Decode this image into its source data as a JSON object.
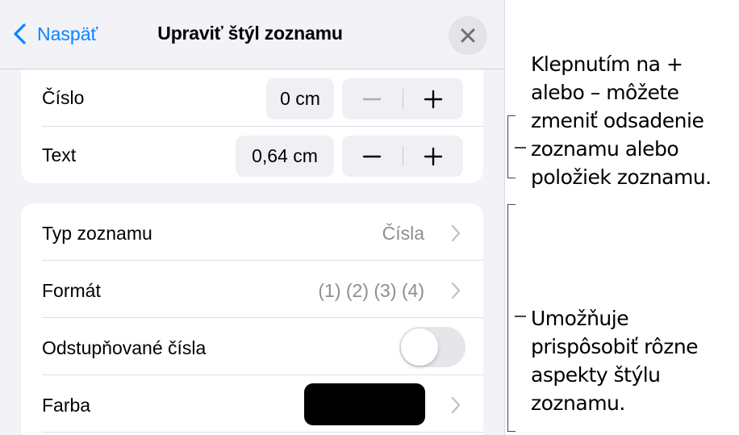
{
  "nav": {
    "back_label": "Naspäť",
    "title": "Upraviť štýl zoznamu"
  },
  "indent": {
    "number": {
      "label": "Číslo",
      "value": "0 cm"
    },
    "text": {
      "label": "Text",
      "value": "0,64 cm"
    },
    "decrement_glyph": "−",
    "increment_glyph": "+"
  },
  "list_settings": {
    "type": {
      "label": "Typ zoznamu",
      "value": "Čísla"
    },
    "format": {
      "label": "Formát",
      "value": "(1) (2) (3) (4)"
    },
    "tiered": {
      "label": "Odstupňované čísla",
      "on": false
    },
    "color": {
      "label": "Farba",
      "value": "#000000"
    }
  },
  "colors": {
    "accent": "#0a84ff",
    "panel_bg": "#f2f2f7",
    "toggle_off": "#e5e5ea",
    "secondary_text": "#8e8e93"
  },
  "callouts": {
    "indent": "Klepnutím na + alebo – môžete zmeniť odsadenie zoznamu alebo položiek zoznamu.",
    "style": "Umožňuje prispôsobiť rôzne aspekty štýlu zoznamu."
  },
  "icons": [
    "chevron-left-icon",
    "close-icon",
    "minus-icon",
    "plus-icon",
    "chevron-right-icon"
  ]
}
